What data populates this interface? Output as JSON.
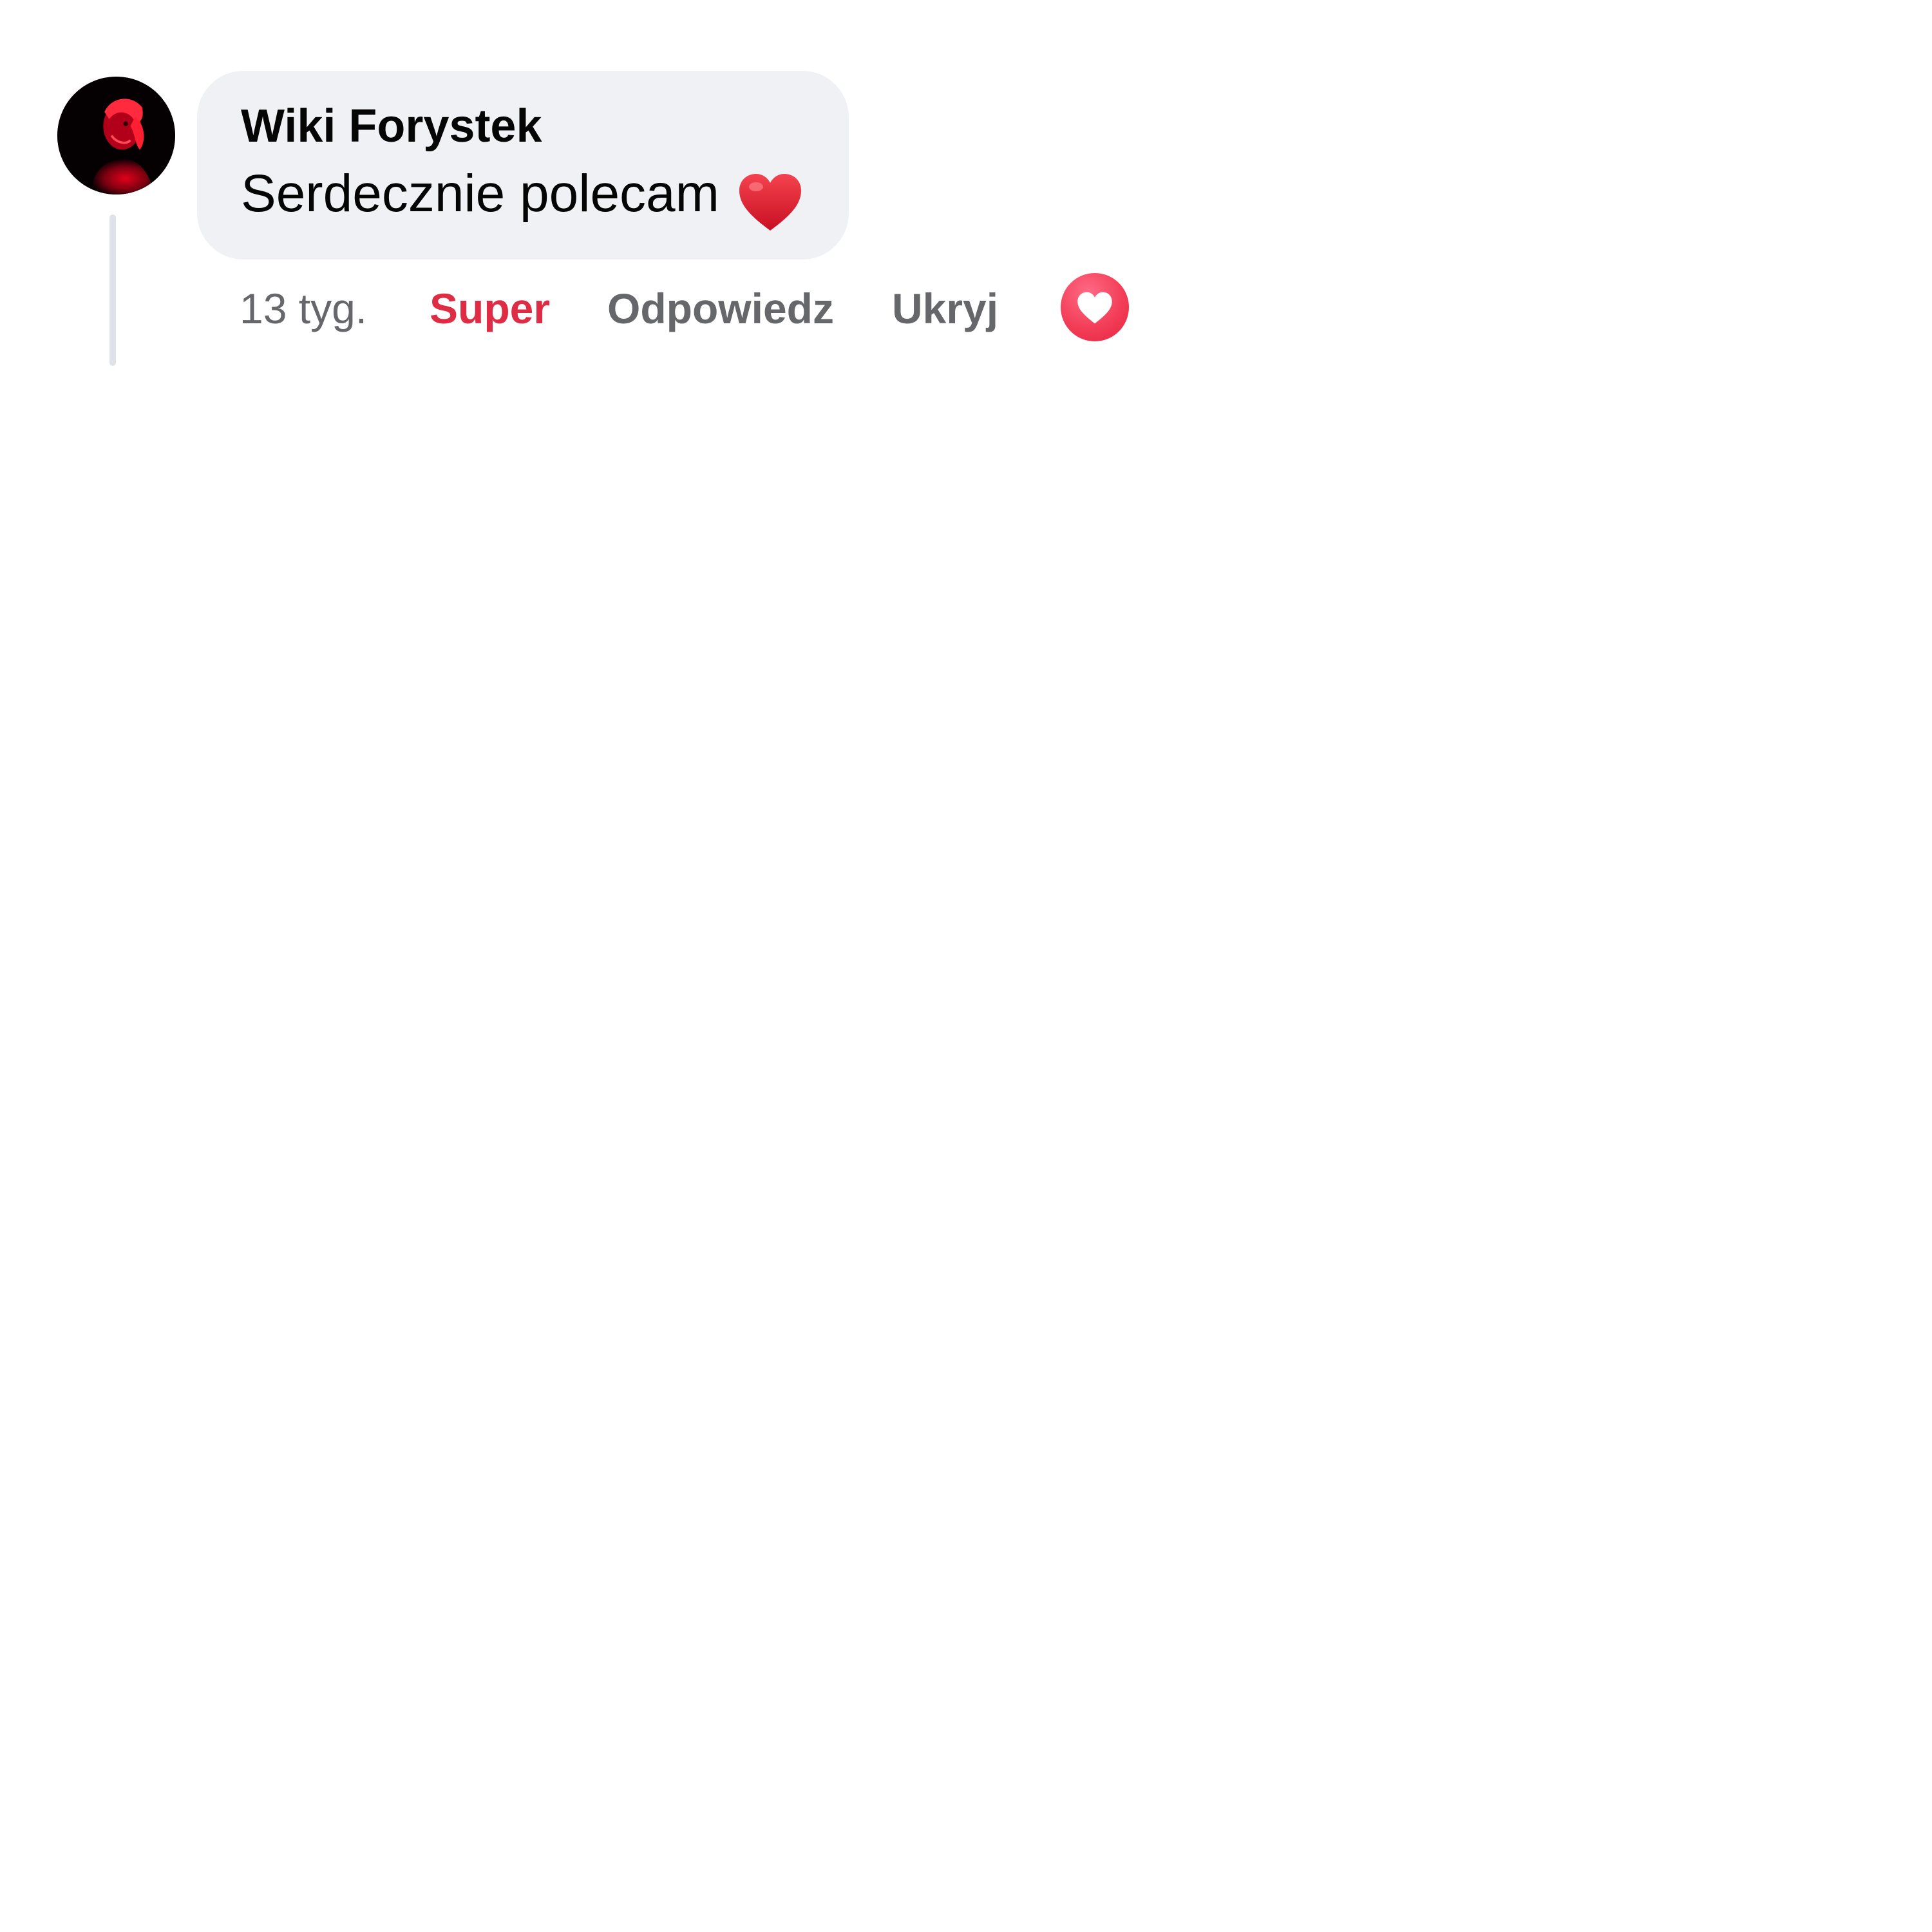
{
  "comment": {
    "author": "Wiki Forystek",
    "text": "Serdecznie polecam",
    "emoji": "heart-emoji",
    "timestamp": "13 tyg.",
    "actions": {
      "like_label": "Super",
      "reply_label": "Odpowiedz",
      "hide_label": "Ukryj"
    },
    "reaction": "love-reaction-icon",
    "colors": {
      "liked_accent": "#dd2c43",
      "action_text": "#65676b",
      "bubble_bg": "#f0f1f4",
      "reaction_bg": "#f33e58",
      "thread_line": "#dfe3e8"
    }
  }
}
